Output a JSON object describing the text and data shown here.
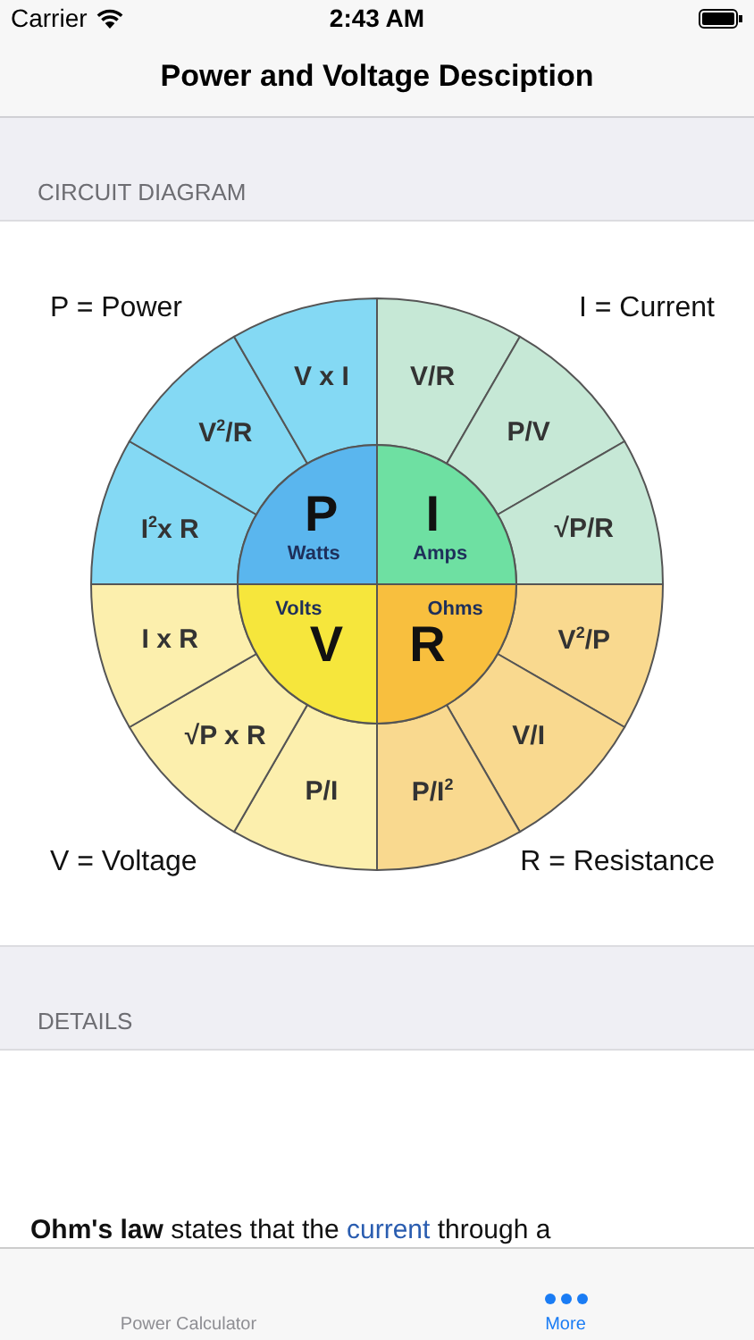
{
  "status_bar": {
    "carrier": "Carrier",
    "time": "2:43 AM"
  },
  "nav": {
    "title": "Power and Voltage Desciption"
  },
  "sections": [
    {
      "header": "CIRCUIT DIAGRAM"
    },
    {
      "header": "DETAILS"
    }
  ],
  "diagram": {
    "quadrants": [
      {
        "letter": "P",
        "unit": "Watts",
        "label": "P = Power",
        "color": "#5ab6ee",
        "formulas": [
          {
            "text": "V x I",
            "color": "#84d9f4"
          },
          {
            "text": "V$^{2}$/R",
            "color": "#84d9f4"
          },
          {
            "text": "I$^{2}$x R",
            "color": "#84d9f4"
          }
        ]
      },
      {
        "letter": "I",
        "unit": "Amps",
        "label": "I = Current",
        "color": "#6ee0a2",
        "formulas": [
          {
            "text": "V/R",
            "color": "#c6e8d6"
          },
          {
            "text": "P/V",
            "color": "#c6e8d6"
          },
          {
            "text": "√P/R",
            "color": "#c6e8d6"
          }
        ]
      },
      {
        "letter": "V",
        "unit": "Volts",
        "label": "V = Voltage",
        "color": "#f6e63c",
        "formulas": [
          {
            "text": "I x R",
            "color": "#fcefad"
          },
          {
            "text": "√P x R",
            "color": "#fcefad"
          },
          {
            "text": "P/I",
            "color": "#fcefad"
          }
        ]
      },
      {
        "letter": "R",
        "unit": "Ohms",
        "label": "R = Resistance",
        "color": "#f8bf3e",
        "formulas": [
          {
            "text": "V$^{2}$/P",
            "color": "#f9d98f"
          },
          {
            "text": "V/I",
            "color": "#f9d98f"
          },
          {
            "text": "P/I$^{2}$",
            "color": "#f9d98f"
          }
        ]
      }
    ]
  },
  "details": {
    "segments": [
      {
        "kind": "bold",
        "text": "Ohm's law"
      },
      {
        "kind": "plain",
        "text": " states that the "
      },
      {
        "kind": "link",
        "text": "current"
      },
      {
        "kind": "plain",
        "text": " through a"
      }
    ]
  },
  "tab_bar": [
    {
      "label": "Power Calculator",
      "kind": "text",
      "selected": false
    },
    {
      "label": "More",
      "kind": "more",
      "selected": true
    }
  ]
}
